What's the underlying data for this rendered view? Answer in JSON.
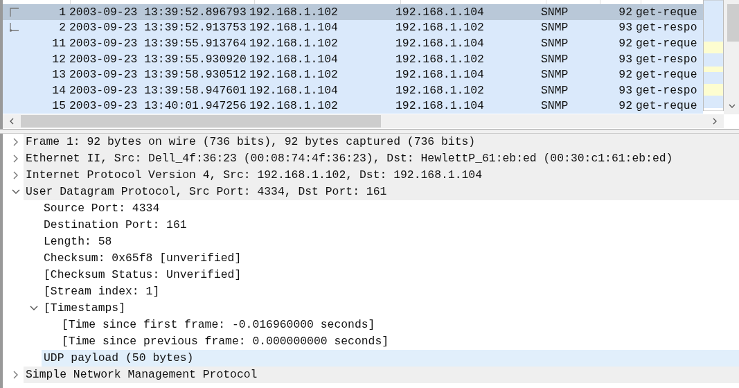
{
  "packets": [
    {
      "no": "1",
      "time": "2003-09-23 13:39:52.896793",
      "source": "192.168.1.102",
      "destination": "192.168.1.104",
      "protocol": "SNMP",
      "length": "92",
      "info": "get-reque",
      "selected": true,
      "link_start": true,
      "link_end": false
    },
    {
      "no": "2",
      "time": "2003-09-23 13:39:52.913753",
      "source": "192.168.1.104",
      "destination": "192.168.1.102",
      "protocol": "SNMP",
      "length": "93",
      "info": "get-respo",
      "selected": false,
      "link_start": false,
      "link_end": true
    },
    {
      "no": "11",
      "time": "2003-09-23 13:39:55.913764",
      "source": "192.168.1.102",
      "destination": "192.168.1.104",
      "protocol": "SNMP",
      "length": "92",
      "info": "get-reque",
      "selected": false
    },
    {
      "no": "12",
      "time": "2003-09-23 13:39:55.930920",
      "source": "192.168.1.104",
      "destination": "192.168.1.102",
      "protocol": "SNMP",
      "length": "93",
      "info": "get-respo",
      "selected": false
    },
    {
      "no": "13",
      "time": "2003-09-23 13:39:58.930512",
      "source": "192.168.1.102",
      "destination": "192.168.1.104",
      "protocol": "SNMP",
      "length": "92",
      "info": "get-reque",
      "selected": false
    },
    {
      "no": "14",
      "time": "2003-09-23 13:39:58.947601",
      "source": "192.168.1.104",
      "destination": "192.168.1.102",
      "protocol": "SNMP",
      "length": "93",
      "info": "get-respo",
      "selected": false
    },
    {
      "no": "15",
      "time": "2003-09-23 13:40:01.947256",
      "source": "192.168.1.102",
      "destination": "192.168.1.104",
      "protocol": "SNMP",
      "length": "92",
      "info": "get-reque",
      "selected": false
    }
  ],
  "details": [
    {
      "text": "Frame 1: 92 bytes on wire (736 bits), 92 bytes captured (736 bits)",
      "expanded": false,
      "selected": false
    },
    {
      "text": "Ethernet II, Src: Dell_4f:36:23 (00:08:74:4f:36:23), Dst: HewlettP_61:eb:ed (00:30:c1:61:eb:ed)",
      "expanded": false,
      "selected": false
    },
    {
      "text": "Internet Protocol Version 4, Src: 192.168.1.102, Dst: 192.168.1.104",
      "expanded": false,
      "selected": false
    },
    {
      "text": "User Datagram Protocol, Src Port: 4334, Dst Port: 161",
      "expanded": true,
      "selected": false,
      "children": [
        {
          "text": "Source Port: 4334",
          "selected": false
        },
        {
          "text": "Destination Port: 161",
          "selected": false
        },
        {
          "text": "Length: 58",
          "selected": false
        },
        {
          "text": "Checksum: 0x65f8 [unverified]",
          "selected": false
        },
        {
          "text": "[Checksum Status: Unverified]",
          "selected": false
        },
        {
          "text": "[Stream index: 1]",
          "selected": false
        },
        {
          "text": "[Timestamps]",
          "expanded": true,
          "selected": false,
          "children": [
            {
              "text": "[Time since first frame: -0.016960000 seconds]",
              "selected": false
            },
            {
              "text": "[Time since previous frame: 0.000000000 seconds]",
              "selected": false
            }
          ]
        },
        {
          "text": "UDP payload (50 bytes)",
          "selected": true
        }
      ]
    },
    {
      "text": "Simple Network Management Protocol",
      "expanded": false,
      "selected": false
    }
  ]
}
